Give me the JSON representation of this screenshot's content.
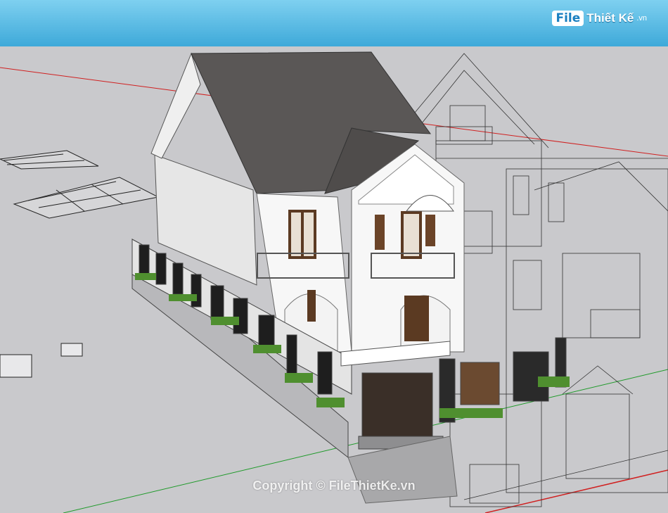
{
  "header": {
    "logo_badge": "File",
    "logo_text": "Thiết Kế",
    "logo_tld": ".vn"
  },
  "watermark": {
    "copyright": "Copyright © FileThietKe.vn"
  },
  "colors": {
    "banner": "#3ea9d9",
    "ground": "#c9c9cc",
    "roof": "#5a5756",
    "wall": "#f7f7f7",
    "axis_red": "#d02020",
    "axis_green": "#1f9a2a"
  }
}
